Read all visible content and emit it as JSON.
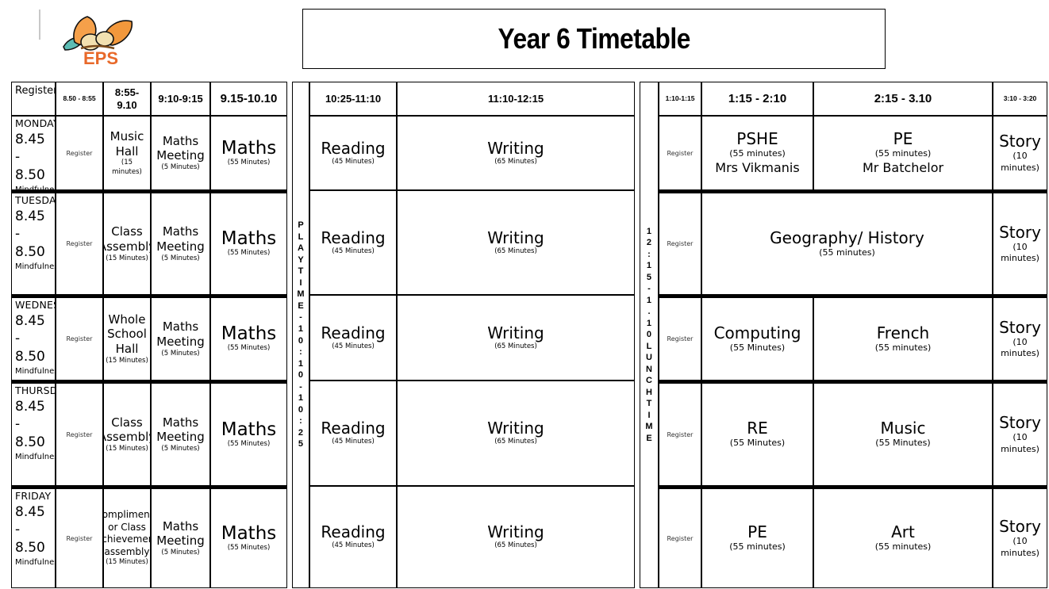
{
  "header": {
    "title": "Year 6 Timetable",
    "logo_text": "EPS",
    "logo_colors": {
      "text": "#e8692a",
      "leaf": "#f5a04a",
      "leaf_dark": "#e07b2a",
      "acorn": "#f0dcae",
      "teal": "#5cbcb4"
    }
  },
  "morning": {
    "headers": [
      "Register",
      "8.50 - 8:55",
      "8:55-9.10",
      "9:10-9:15",
      "9.15-10.10"
    ],
    "rows": [
      {
        "day": "MONDAY",
        "day_time": "8.45 - 8.50",
        "day_note": "Mindfulness",
        "register": "Register",
        "slot2": {
          "subject": "Music Hall",
          "duration": "(15 minutes)"
        },
        "slot3": {
          "subject": "Maths Meeting",
          "duration": "(5 Minutes)"
        },
        "slot4": {
          "subject": "Maths",
          "duration": "(55 Minutes)"
        }
      },
      {
        "day": "TUESDAY",
        "day_time": "8.45 - 8.50",
        "day_note": "Mindfulness",
        "register": "Register",
        "slot2": {
          "subject": "Class Assembly",
          "duration": "(15 Minutes)"
        },
        "slot3": {
          "subject": "Maths Meeting",
          "duration": "(5 Minutes)"
        },
        "slot4": {
          "subject": "Maths",
          "duration": "(55 Minutes)"
        }
      },
      {
        "day": "WEDNESDAY",
        "day_time": "8.45 - 8.50",
        "day_note": "Mindfulness",
        "register": "Register",
        "slot2": {
          "subject": "Whole School Hall",
          "duration": "(15 Minutes)"
        },
        "slot3": {
          "subject": "Maths Meeting",
          "duration": "(5 Minutes)"
        },
        "slot4": {
          "subject": "Maths",
          "duration": "(55 Minutes)"
        }
      },
      {
        "day": "THURSDAY",
        "day_time": "8.45 - 8.50",
        "day_note": "Mindfulness",
        "register": "Register",
        "slot2": {
          "subject": "Class Assembly",
          "duration": "(15 Minutes)"
        },
        "slot3": {
          "subject": "Maths Meeting",
          "duration": "(5 Minutes)"
        },
        "slot4": {
          "subject": "Maths",
          "duration": "(55 Minutes)"
        }
      },
      {
        "day": "FRIDAY",
        "day_time": "8.45 - 8.50",
        "day_note": "Mindfulness",
        "register": "Register",
        "slot2": {
          "subject": "Compliments or Class achievement assembly",
          "duration": "(15 Minutes)"
        },
        "slot3": {
          "subject": "Maths Meeting",
          "duration": "(5 Minutes)"
        },
        "slot4": {
          "subject": "Maths",
          "duration": "(55 Minutes)"
        }
      }
    ]
  },
  "playtime": {
    "label": "PLAYTIME - 10:10 - 10:25"
  },
  "midday": {
    "headers": [
      "10:25-11:10",
      "11:10-12:15"
    ],
    "rows": [
      {
        "slot1": {
          "subject": "Reading",
          "duration": "(45 Minutes)"
        },
        "slot2": {
          "subject": "Writing",
          "duration": "(65 Minutes)"
        }
      },
      {
        "slot1": {
          "subject": "Reading",
          "duration": "(45 Minutes)"
        },
        "slot2": {
          "subject": "Writing",
          "duration": "(65 Minutes)"
        }
      },
      {
        "slot1": {
          "subject": "Reading",
          "duration": "(45 Minutes)"
        },
        "slot2": {
          "subject": "Writing",
          "duration": "(65 Minutes)"
        }
      },
      {
        "slot1": {
          "subject": "Reading",
          "duration": "(45 Minutes)"
        },
        "slot2": {
          "subject": "Writing",
          "duration": "(65 Minutes)"
        }
      },
      {
        "slot1": {
          "subject": "Reading",
          "duration": "(45 Minutes)"
        },
        "slot2": {
          "subject": "Writing",
          "duration": "(65 Minutes)"
        }
      }
    ]
  },
  "lunchtime": {
    "label": "12:15 - 1.10 LUNCHTIME"
  },
  "afternoon": {
    "headers": [
      "1:10-1:15",
      "1:15 - 2:10",
      "2:15 - 3.10",
      "3:10 - 3:20"
    ],
    "rows": [
      {
        "register": "Register",
        "merged": false,
        "slot1": {
          "subject": "PSHE",
          "duration": "(55 minutes)",
          "teacher": "Mrs Vikmanis"
        },
        "slot2": {
          "subject": "PE",
          "duration": "(55 minutes)",
          "teacher": "Mr Batchelor"
        },
        "story": {
          "subject": "Story",
          "duration": "(10 minutes)"
        }
      },
      {
        "register": "Register",
        "merged": true,
        "merged_slot": {
          "subject": "Geography/ History",
          "duration": "(55 minutes)"
        },
        "story": {
          "subject": "Story",
          "duration": "(10 minutes)"
        }
      },
      {
        "register": "Register",
        "merged": false,
        "slot1": {
          "subject": "Computing",
          "duration": "(55 Minutes)"
        },
        "slot2": {
          "subject": "French",
          "duration": "(55 minutes)"
        },
        "story": {
          "subject": "Story",
          "duration": "(10 minutes)"
        }
      },
      {
        "register": "Register",
        "merged": false,
        "slot1": {
          "subject": "RE",
          "duration": "(55 Minutes)"
        },
        "slot2": {
          "subject": "Music",
          "duration": "(55 Minutes)"
        },
        "story": {
          "subject": "Story",
          "duration": "(10 minutes)"
        }
      },
      {
        "register": "Register",
        "merged": false,
        "slot1": {
          "subject": "PE",
          "duration": "(55 minutes)"
        },
        "slot2": {
          "subject": "Art",
          "duration": "(55 minutes)"
        },
        "story": {
          "subject": "Story",
          "duration": "(10 minutes)"
        }
      }
    ]
  }
}
